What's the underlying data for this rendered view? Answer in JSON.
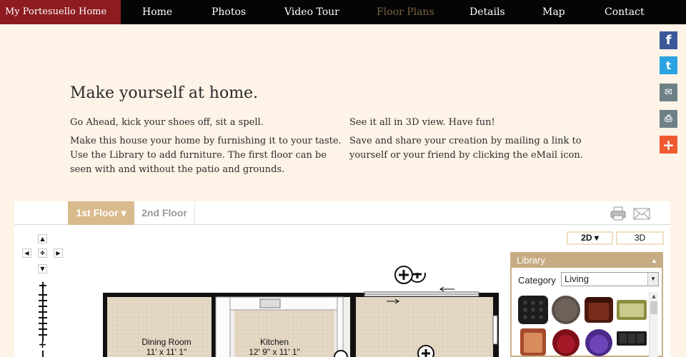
{
  "nav": {
    "brand": "My Portesuello Home",
    "items": [
      "Home",
      "Photos",
      "Video Tour",
      "Floor Plans",
      "Details",
      "Map",
      "Contact"
    ],
    "active_index": 3,
    "colors": {
      "bar": "#050505",
      "brand": "#8d1b1f",
      "active": "#7a6242"
    }
  },
  "social": [
    {
      "icon": "facebook-icon",
      "glyph": "f"
    },
    {
      "icon": "twitter-icon",
      "glyph": "t"
    },
    {
      "icon": "email-icon",
      "glyph": "✉"
    },
    {
      "icon": "print-icon",
      "glyph": "⎙"
    },
    {
      "icon": "plus-icon",
      "glyph": "+"
    }
  ],
  "intro": {
    "headline": "Make yourself at home.",
    "left_p1": "Go Ahead, kick your shoes off, sit a spell.",
    "left_p2": "Make this house your home by furnishing it to your taste. Use the Library to add furniture. The first floor can be seen with and without the patio and grounds.",
    "right_p1": "See it all in 3D view. Have fun!",
    "right_p2": "Save and share your creation by mailing a link to yourself or your friend by clicking the eMail icon."
  },
  "planner": {
    "tab_active": "1st Floor ▾",
    "tab_other": "2nd Floor",
    "view_2d": "2D ▾",
    "view_3d": "3D",
    "nav_glyphs": {
      "up": "▲",
      "down": "▼",
      "left": "◀",
      "right": "▶",
      "center": "✥"
    },
    "rooms": [
      {
        "name": "Dining Room",
        "size": "11' x 11' 1\""
      },
      {
        "name": "Kitchen",
        "size": "12' 9\" x 11' 1\""
      }
    ]
  },
  "library": {
    "title": "Library",
    "collapse_glyph": "▲",
    "category_label": "Category",
    "category_value": "Living",
    "items": [
      "black-tufted-ottoman",
      "round-wood-table",
      "brown-armchair",
      "olive-sofa",
      "copper-chair",
      "red-round-chair",
      "purple-round-chair",
      "black-sofa"
    ]
  }
}
